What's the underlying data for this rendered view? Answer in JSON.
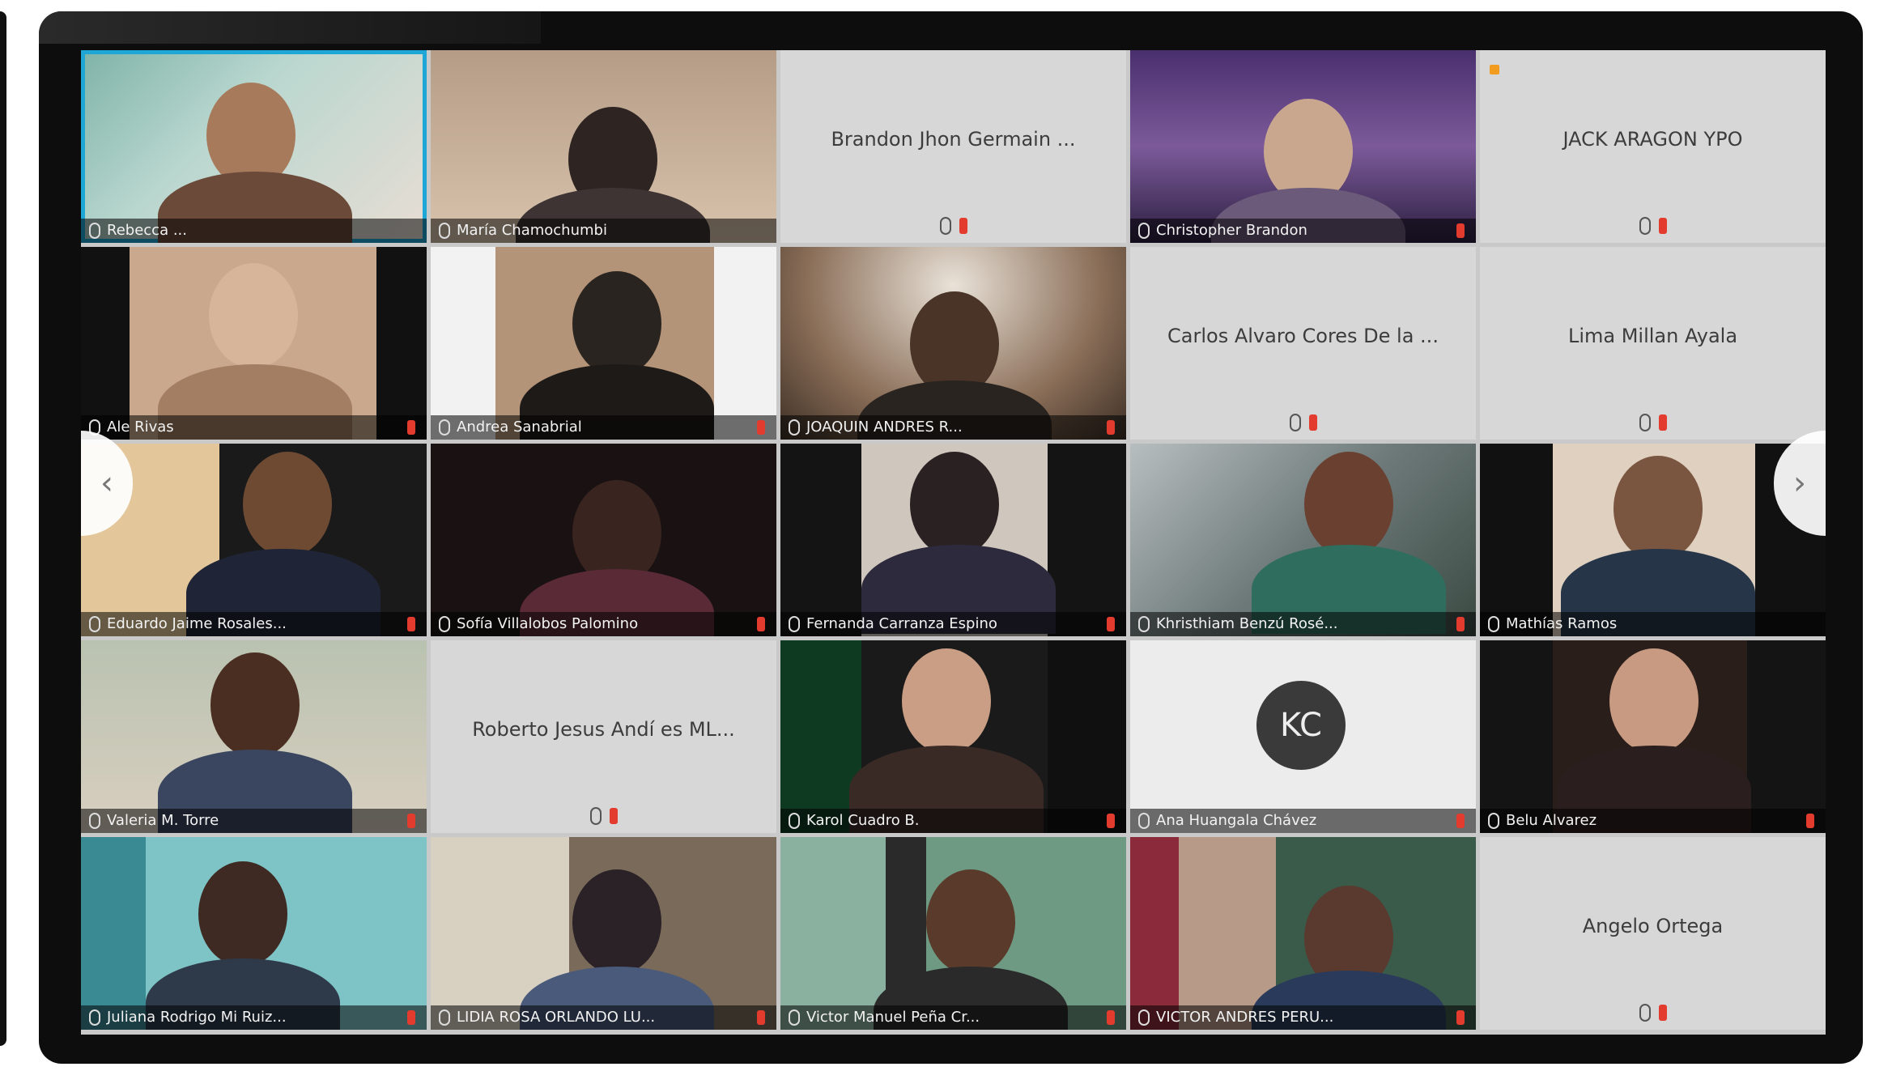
{
  "meeting": {
    "participants": [
      {
        "name": "Rebecca ...",
        "video": true,
        "active": true
      },
      {
        "name": "María Chamochumbi",
        "video": true
      },
      {
        "name": "Brandon Jhon Germain ...",
        "video": false
      },
      {
        "name": "Christopher Brandon",
        "video": true
      },
      {
        "name": "JACK ARAGON YPO",
        "video": false
      },
      {
        "name": "Ale Rivas",
        "video": true
      },
      {
        "name": "Andrea Sanabrial",
        "video": true
      },
      {
        "name": "JOAQUIN ANDRES R...",
        "video": true
      },
      {
        "name": "Carlos Alvaro Cores De la ...",
        "video": false
      },
      {
        "name": "Lima Millan Ayala",
        "video": false
      },
      {
        "name": "Eduardo Jaime Rosales...",
        "video": true
      },
      {
        "name": "Sofía Villalobos Palomino",
        "video": true
      },
      {
        "name": "Fernanda Carranza Espino",
        "video": true
      },
      {
        "name": "Khristhiam Benzú Rosé...",
        "video": true
      },
      {
        "name": "Mathías Ramos",
        "video": true
      },
      {
        "name": "Valeria M. Torre",
        "video": true
      },
      {
        "name": "Roberto Jesus Andí es ML...",
        "video": false
      },
      {
        "name": "Karol Cuadro B.",
        "video": true
      },
      {
        "name": "Ana Huangala Chávez",
        "video": true,
        "avatar": "KC"
      },
      {
        "name": "Belu Alvarez",
        "video": true
      },
      {
        "name": "Juliana Rodrigo Mi Ruiz...",
        "video": true
      },
      {
        "name": "LIDIA ROSA ORLANDO LU...",
        "video": true
      },
      {
        "name": "Victor Manuel Peña Cr...",
        "video": true
      },
      {
        "name": "VICTOR ANDRES PERU...",
        "video": true
      },
      {
        "name": "Angelo Ortega",
        "video": false
      }
    ],
    "nav": {
      "prev": "‹",
      "next": "›"
    },
    "colors": {
      "active_border": "#1ea7d6",
      "muted": "#e33b2e"
    }
  }
}
